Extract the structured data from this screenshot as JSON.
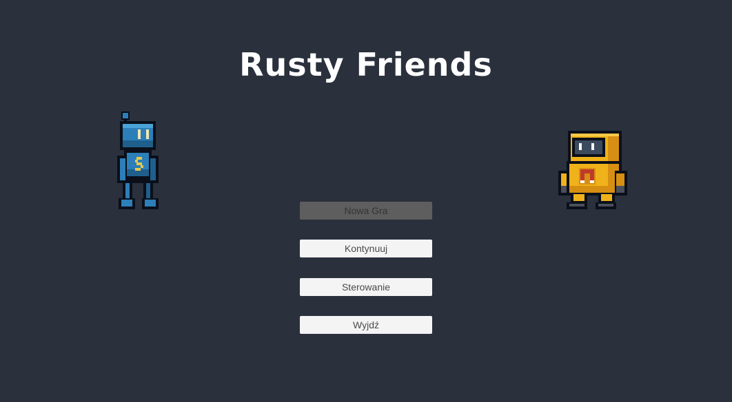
{
  "game": {
    "title": "Rusty Friends"
  },
  "menu": {
    "items": [
      {
        "label": "Nowa Gra",
        "selected": true
      },
      {
        "label": "Kontynuuj",
        "selected": false
      },
      {
        "label": "Sterowanie",
        "selected": false
      },
      {
        "label": "Wyjdź",
        "selected": false
      }
    ]
  },
  "sprites": {
    "left": "blue-robot-sprite",
    "right": "yellow-robot-sprite"
  },
  "colors": {
    "background": "#2a303c",
    "button": "#f4f4f4",
    "button_selected": "#5e5e5e",
    "title": "#ffffff"
  }
}
